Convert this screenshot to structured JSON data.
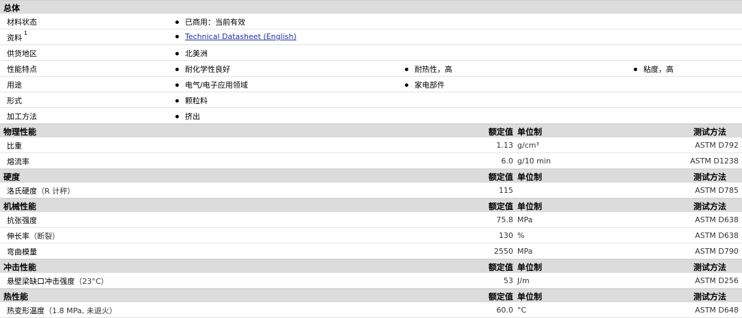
{
  "general": {
    "title": "总体",
    "rows": [
      {
        "label": "材料状态",
        "items": [
          "已商用：当前有效"
        ]
      },
      {
        "label": "资料",
        "sup": "1",
        "items": [
          "Technical Datasheet (English)"
        ],
        "link": true
      },
      {
        "label": "供货地区",
        "items": [
          "北美洲"
        ]
      },
      {
        "label": "性能特点",
        "items": [
          "耐化学性良好",
          "耐热性，高",
          "粘度，高"
        ]
      },
      {
        "label": "用途",
        "items": [
          "电气/电子应用领域",
          "家电部件"
        ]
      },
      {
        "label": "形式",
        "items": [
          "颗粒料"
        ]
      },
      {
        "label": "加工方法",
        "items": [
          "挤出"
        ]
      }
    ]
  },
  "headers": {
    "value": "额定值",
    "unit": "单位制",
    "method": "测试方法"
  },
  "sections": [
    {
      "title": "物理性能",
      "rows": [
        {
          "label": "比重",
          "value": "1.13",
          "unit": "g/cm³",
          "method": "ASTM D792"
        },
        {
          "label": "熔流率",
          "value": "6.0",
          "unit": "g/10 min",
          "method": "ASTM D1238"
        }
      ]
    },
    {
      "title": "硬度",
      "rows": [
        {
          "label": "洛氏硬度",
          "note": "（R 计秤）",
          "value": "115",
          "unit": "",
          "method": "ASTM D785"
        }
      ]
    },
    {
      "title": "机械性能",
      "rows": [
        {
          "label": "抗张强度",
          "value": "75.8",
          "unit": "MPa",
          "method": "ASTM D638"
        },
        {
          "label": "伸长率",
          "note": "（断裂）",
          "value": "130",
          "unit": "%",
          "method": "ASTM D638"
        },
        {
          "label": "弯曲模量",
          "value": "2550",
          "unit": "MPa",
          "method": "ASTM D790"
        }
      ]
    },
    {
      "title": "冲击性能",
      "rows": [
        {
          "label": "悬壁梁缺口冲击强度",
          "note": "（23°C）",
          "value": "53",
          "unit": "J/m",
          "method": "ASTM D256"
        }
      ]
    },
    {
      "title": "热性能",
      "rows": [
        {
          "label": "热变形温度",
          "note": "（1.8 MPa, 未退火）",
          "value": "60.0",
          "unit": "°C",
          "method": "ASTM D648"
        }
      ]
    }
  ]
}
